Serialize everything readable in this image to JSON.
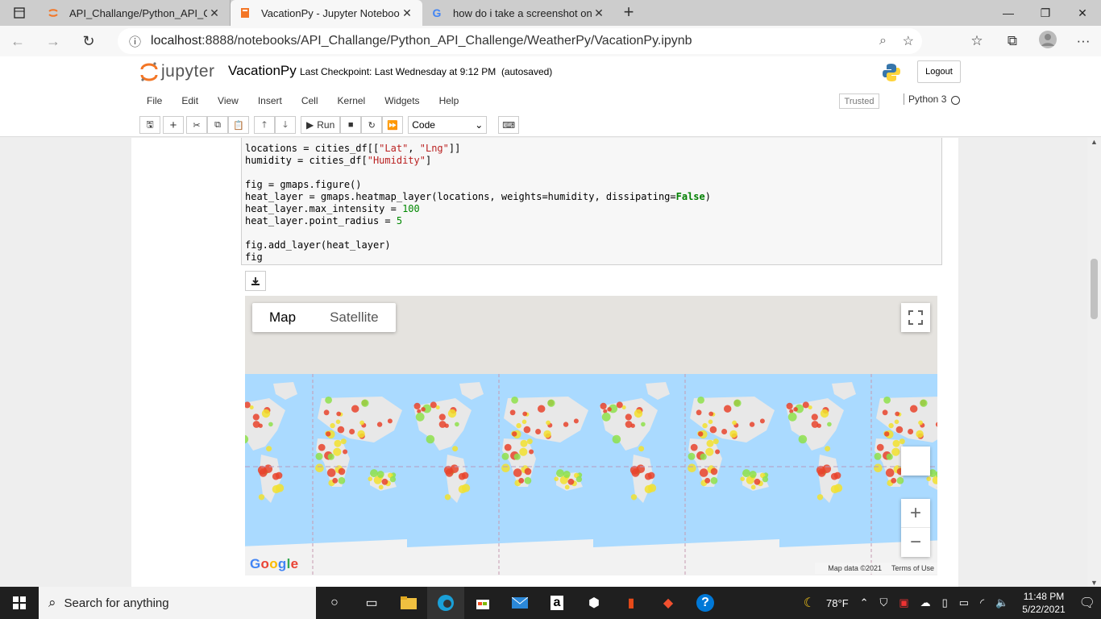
{
  "browser": {
    "tabs": [
      {
        "title": "API_Challange/Python_API_Chall"
      },
      {
        "title": "VacationPy - Jupyter Notebook"
      },
      {
        "title": "how do i take a screenshot on m"
      }
    ],
    "url_host": "localhost",
    "url_path": ":8888/notebooks/API_Challange/Python_API_Challenge/WeatherPy/VacationPy.ipynb"
  },
  "notebook": {
    "logo_text": "jupyter",
    "name": "VacationPy",
    "checkpoint": "Last Checkpoint: Last Wednesday at 9:12 PM",
    "autosave": "(autosaved)",
    "logout": "Logout",
    "menu": [
      "File",
      "Edit",
      "View",
      "Insert",
      "Cell",
      "Kernel",
      "Widgets",
      "Help"
    ],
    "trusted": "Trusted",
    "kernel": "Python 3",
    "run_label": "Run",
    "cell_type": "Code"
  },
  "code": {
    "l1a": "locations = cities_df[[",
    "l1s1": "\"Lat\"",
    "l1b": ", ",
    "l1s2": "\"Lng\"",
    "l1c": "]]",
    "l2a": "humidity = cities_df[",
    "l2s": "\"Humidity\"",
    "l2b": "]",
    "l3": "fig = gmaps.figure()",
    "l4a": "heat_layer = gmaps.heatmap_layer(locations, weights=humidity, dissipating=",
    "l4k": "False",
    "l4b": ")",
    "l5a": "heat_layer.max_intensity = ",
    "l5n": "100",
    "l6a": "heat_layer.point_radius = ",
    "l6n": "5",
    "l7": "fig.add_layer(heat_layer)",
    "l8": "fig"
  },
  "map": {
    "type_map": "Map",
    "type_satellite": "Satellite",
    "zoom_in": "+",
    "zoom_out": "−",
    "logo": "Google",
    "map_data": "Map data ©2021",
    "terms": "Terms of Use",
    "colors": {
      "ocean": "#aadaff",
      "land": "#e8e8e8",
      "heat_hot": "#e8432c",
      "heat_warm": "#f2e02e",
      "heat_cool": "#8ee04a"
    }
  },
  "taskbar": {
    "search": "Search for anything",
    "temp": "78°F",
    "time": "11:48 PM",
    "date": "5/22/2021"
  }
}
